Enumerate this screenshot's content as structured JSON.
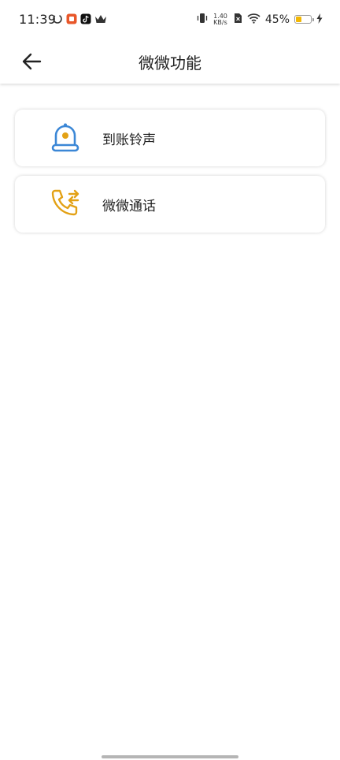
{
  "status_bar": {
    "time": "11:39",
    "net_speed_value": "1.40",
    "net_speed_unit": "KB/s",
    "battery_percent": "45%",
    "battery_level": 0.45,
    "left_icons": [
      "sync-icon",
      "app-badge-icon",
      "tiktok-icon",
      "crown-icon"
    ],
    "right_icons": [
      "vibrate-icon",
      "sim-off-icon",
      "wifi-icon",
      "battery-icon",
      "charging-icon"
    ]
  },
  "header": {
    "title": "微微功能",
    "back_icon": "arrow-left-icon"
  },
  "features": [
    {
      "label": "到账铃声",
      "icon": "bell-icon",
      "color": "#3b87d6"
    },
    {
      "label": "微微通话",
      "icon": "phone-transfer-icon",
      "color": "#e3a115"
    }
  ]
}
